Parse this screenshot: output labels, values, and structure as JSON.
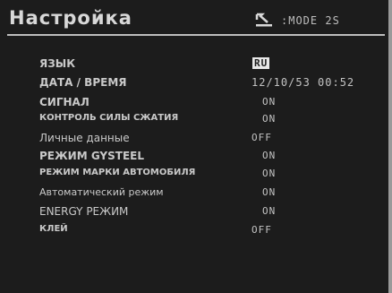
{
  "header": {
    "title": "Настройка",
    "mode_label": ":MODE 2S",
    "mode_icon": "return-arrow-icon"
  },
  "settings": [
    {
      "label": "ЯЗЫК",
      "value": "RU",
      "selected": true
    },
    {
      "label": "ДАТА / ВРЕМЯ",
      "value": "12/10/53 00:52"
    },
    {
      "label": "СИГНАЛ",
      "value": "ON"
    },
    {
      "label": "КОНТРОЛЬ СИЛЫ СЖАТИЯ",
      "value": "ON"
    },
    {
      "label": "Личные данные",
      "value": "OFF"
    },
    {
      "label": "РЕЖИМ GYSTEEL",
      "value": "ON"
    },
    {
      "label": "РЕЖИМ МАРКИ АВТОМОБИЛЯ",
      "value": "ON"
    },
    {
      "label": "Автоматический режим",
      "value": "ON"
    },
    {
      "label": "ENERGY РЕЖИМ",
      "value": "ON"
    },
    {
      "label": "КЛЕЙ",
      "value": "OFF"
    }
  ],
  "colors": {
    "background": "#1c1c1c",
    "text": "#c9c9c9",
    "highlight": "#e8e8e8"
  }
}
